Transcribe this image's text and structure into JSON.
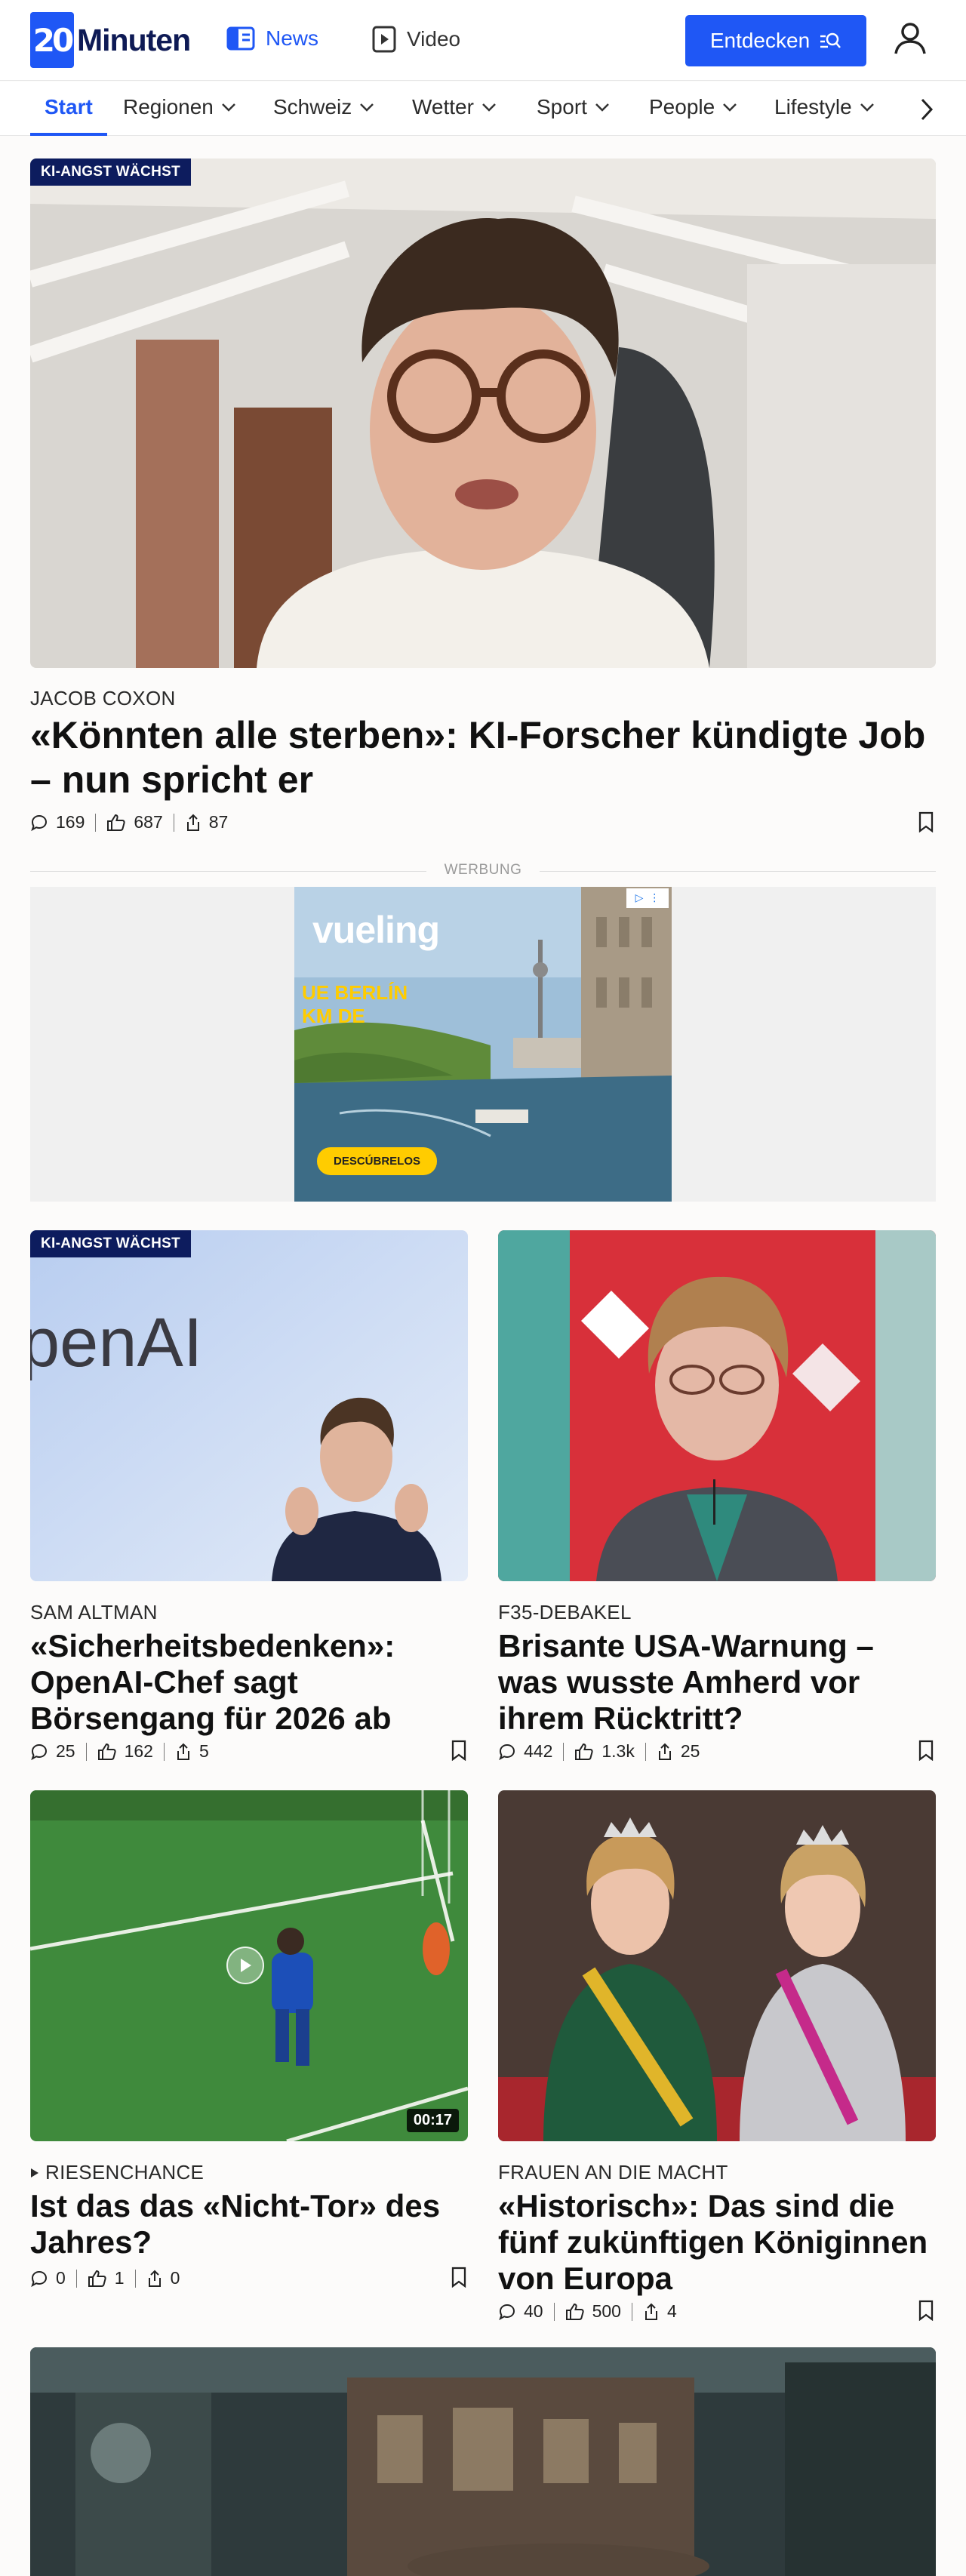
{
  "header": {
    "logo_mark": "20",
    "logo_text": "Minuten",
    "nav_news": "News",
    "nav_video": "Video",
    "discover_button": "Entdecken",
    "accent_color": "#1f57f5"
  },
  "subnav": {
    "items": [
      "Start",
      "Regionen",
      "Schweiz",
      "Wetter",
      "Sport",
      "People",
      "Lifestyle"
    ],
    "active": "Start"
  },
  "articles": {
    "a1": {
      "tag": "KI-ANGST WÄCHST",
      "kicker": "JACOB COXON",
      "title": "«Könnten alle sterben»: KI-Forscher kündigte Job – nun spricht er",
      "comments": "169",
      "likes": "687",
      "shares": "87"
    },
    "a2": {
      "tag": "KI-ANGST WÄCHST",
      "image_text": "penAI",
      "kicker": "SAM ALTMAN",
      "title": "«Sicherheitsbedenken»: OpenAI-Chef sagt Börsengang für 2026 ab",
      "comments": "25",
      "likes": "162",
      "shares": "5"
    },
    "a3": {
      "kicker": "F35-DEBAKEL",
      "title": "Brisante USA-Warnung – was wusste Amherd vor ihrem Rücktritt?",
      "comments": "442",
      "likes": "1.3k",
      "shares": "25"
    },
    "a4": {
      "kicker": "RIESENCHANCE",
      "title": "Ist das das «Nicht-Tor» des Jahres?",
      "duration": "00:17",
      "comments": "0",
      "likes": "1",
      "shares": "0"
    },
    "a5": {
      "kicker": "FRAUEN AN DIE MACHT",
      "title": "«Historisch»: Das sind die fünf zukünftigen Königinnen von Europa",
      "comments": "40",
      "likes": "500",
      "shares": "4"
    }
  },
  "ad": {
    "label": "WERBUNG",
    "brand": "vueling",
    "copy_line1": "UE BERLÍN",
    "copy_line2": "KM DE",
    "cta": "DESCÚBRELOS"
  }
}
